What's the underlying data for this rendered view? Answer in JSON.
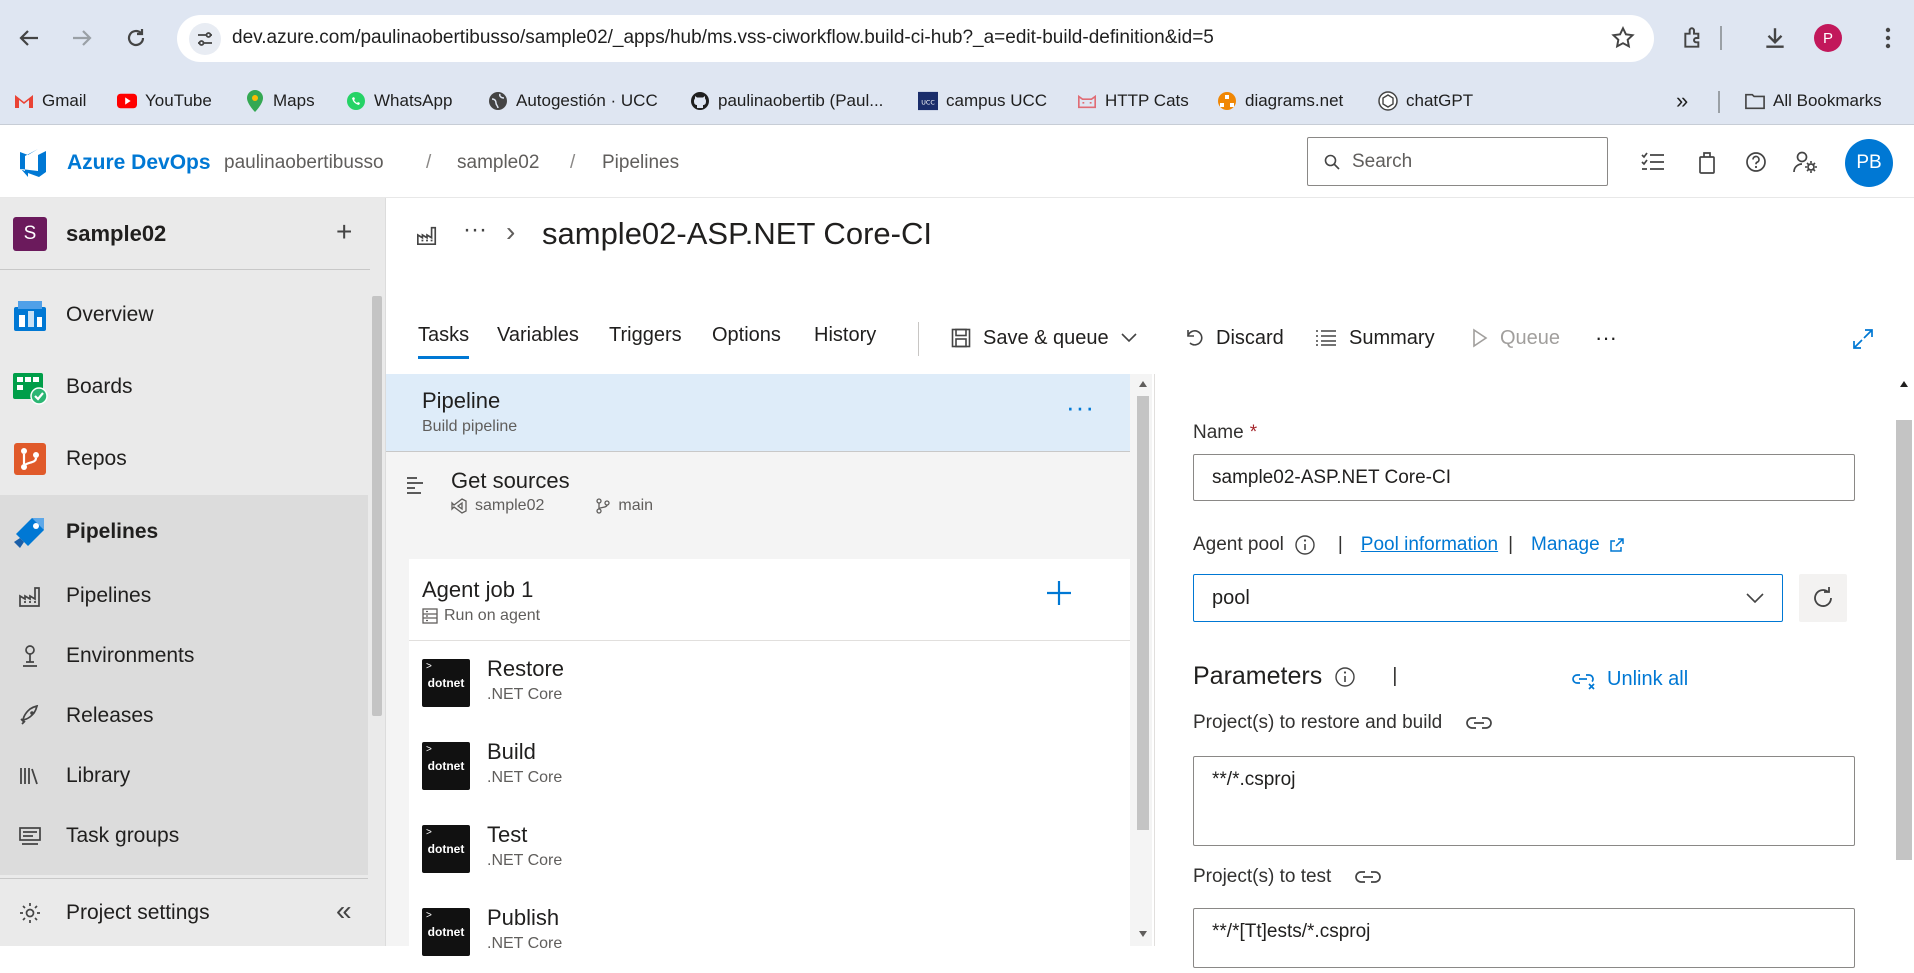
{
  "browser": {
    "url": "dev.azure.com/paulinaobertibusso/sample02/_apps/hub/ms.vss-ciworkflow.build-ci-hub?_a=edit-build-definition&id=5",
    "profile_initial": "P",
    "bookmarks": [
      {
        "label": "Gmail"
      },
      {
        "label": "YouTube"
      },
      {
        "label": "Maps"
      },
      {
        "label": "WhatsApp"
      },
      {
        "label": "Autogestión · UCC"
      },
      {
        "label": "paulinaobertib (Paul..."
      },
      {
        "label": "campus UCC"
      },
      {
        "label": "HTTP Cats"
      },
      {
        "label": "diagrams.net"
      },
      {
        "label": "chatGPT"
      }
    ],
    "all_bookmarks": "All Bookmarks",
    "overflow": "»"
  },
  "header": {
    "brand": "Azure DevOps",
    "breadcrumb": [
      "paulinaobertibusso",
      "sample02",
      "Pipelines"
    ],
    "separator": "/",
    "search_placeholder": "Search",
    "avatar_initials": "PB"
  },
  "sidebar": {
    "project_initial": "S",
    "project_name": "sample02",
    "add": "+",
    "items": [
      {
        "label": "Overview"
      },
      {
        "label": "Boards"
      },
      {
        "label": "Repos"
      },
      {
        "label": "Pipelines"
      }
    ],
    "sub_items": [
      {
        "label": "Pipelines"
      },
      {
        "label": "Environments"
      },
      {
        "label": "Releases"
      },
      {
        "label": "Library"
      },
      {
        "label": "Task groups"
      }
    ],
    "settings": "Project settings",
    "collapse": "«"
  },
  "main": {
    "ellipsis": "···",
    "chevron": "›",
    "title": "sample02-ASP.NET Core-CI",
    "tabs": [
      "Tasks",
      "Variables",
      "Triggers",
      "Options",
      "History"
    ],
    "save_queue": "Save & queue",
    "discard": "Discard",
    "summary": "Summary",
    "queue": "Queue",
    "more": "···"
  },
  "tasks": {
    "pipeline_title": "Pipeline",
    "pipeline_sub": "Build pipeline",
    "pipeline_more": "···",
    "get_sources": "Get sources",
    "repo": "sample02",
    "branch": "main",
    "job_title": "Agent job 1",
    "job_sub": "Run on agent",
    "logo_text": "dotnet",
    "items": [
      {
        "title": "Restore",
        "sub": ".NET Core"
      },
      {
        "title": "Build",
        "sub": ".NET Core"
      },
      {
        "title": "Test",
        "sub": ".NET Core"
      },
      {
        "title": "Publish",
        "sub": ".NET Core"
      }
    ]
  },
  "props": {
    "name_label": "Name",
    "required_mark": "*",
    "name_value": "sample02-ASP.NET Core-CI",
    "agent_pool_label": "Agent pool",
    "pipe": "|",
    "pool_info": "Pool information",
    "manage": "Manage",
    "pool_value": "pool",
    "parameters": "Parameters",
    "unlink_all": "Unlink all",
    "restore_label": "Project(s) to restore and build",
    "restore_value": "**/*.csproj",
    "test_label": "Project(s) to test",
    "test_value": "**/*[Tt]ests/*.csproj"
  }
}
